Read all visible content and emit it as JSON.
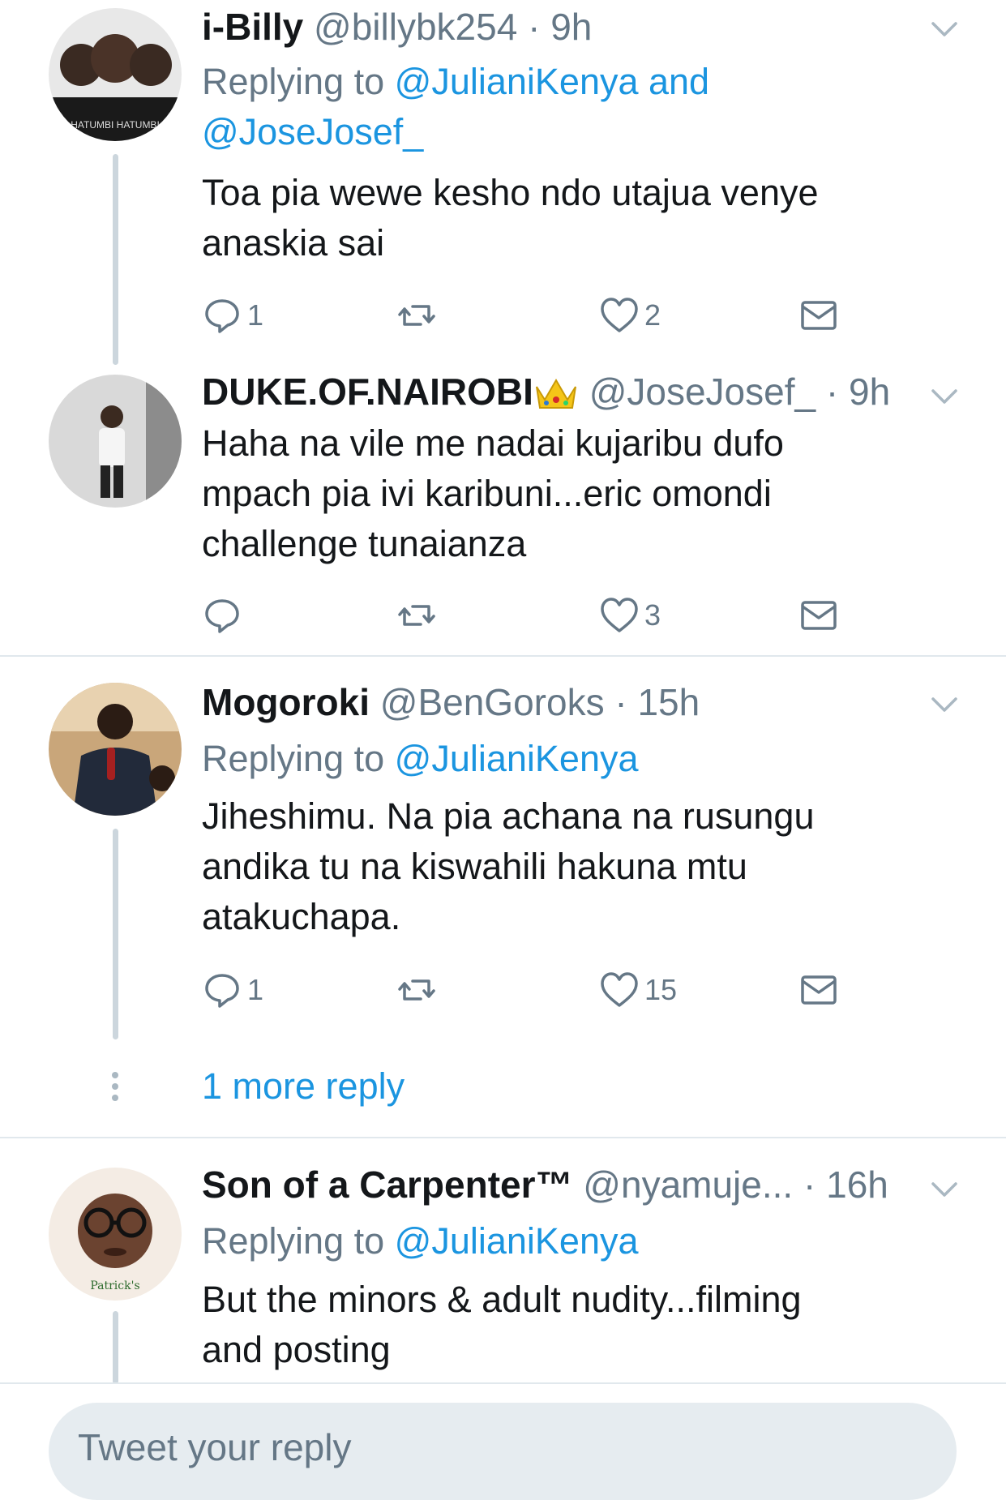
{
  "tweets": [
    {
      "name": "i-Billy",
      "handle": "@billybk254",
      "time": "9h",
      "replying_label": "Replying to",
      "replying_to": "@JulianiKenya and @JoseJosef_",
      "replying_to_a": "@JulianiKenya and",
      "replying_to_b": "@JoseJosef_",
      "text_lines": [
        "Toa pia wewe kesho ndo utajua venye",
        "anaskia sai"
      ],
      "replies": "1",
      "likes": "2"
    },
    {
      "name": "DUKE.OF.NAIROBI",
      "handle": "@JoseJosef_",
      "time": "9h",
      "text_lines": [
        "Haha na vile me nadai kujaribu dufo",
        "mpach pia ivi karibuni...eric omondi",
        "challenge tunaianza"
      ],
      "replies": "",
      "likes": "3"
    },
    {
      "name": "Mogoroki",
      "handle": "@BenGoroks",
      "time": "15h",
      "replying_label": "Replying to",
      "replying_to": "@JulianiKenya",
      "text_lines": [
        "Jiheshimu. Na pia achana na rusungu",
        "andika tu na kiswahili hakuna mtu",
        "atakuchapa."
      ],
      "replies": "1",
      "likes": "15"
    },
    {
      "name": "Son of a Carpenter™",
      "handle": "@nyamuje...",
      "time": "16h",
      "replying_label": "Replying to",
      "replying_to": "@JulianiKenya",
      "text_lines": [
        "But the minors & adult nudity...filming",
        "and posting"
      ]
    }
  ],
  "more_replies": "1 more reply",
  "composer": {
    "placeholder": "Tweet your reply"
  },
  "colors": {
    "link": "#1b95e0",
    "muted": "#657786",
    "thread": "#ccd6dd",
    "divider": "#e1e8ed"
  },
  "icons": [
    "reply-icon",
    "retweet-icon",
    "like-icon",
    "message-icon",
    "chevron-down-icon"
  ]
}
